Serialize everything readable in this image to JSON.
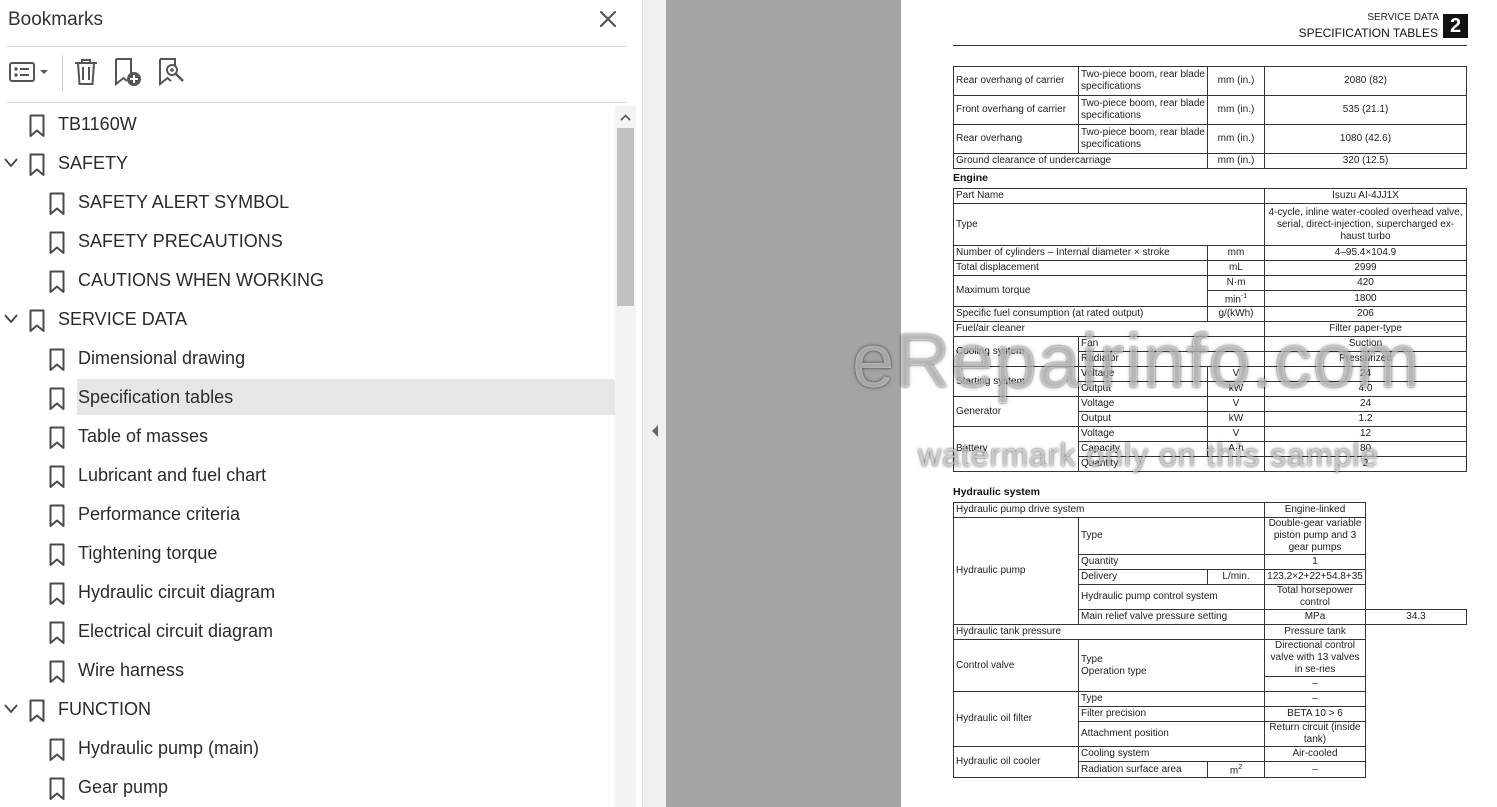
{
  "panel": {
    "title": "Bookmarks"
  },
  "bookmarks": [
    {
      "label": "TB1160W",
      "level": 0,
      "expandable": false
    },
    {
      "label": "SAFETY",
      "level": 0,
      "expandable": true
    },
    {
      "label": "SAFETY ALERT SYMBOL",
      "level": 1
    },
    {
      "label": "SAFETY PRECAUTIONS",
      "level": 1
    },
    {
      "label": "CAUTIONS WHEN WORKING",
      "level": 1
    },
    {
      "label": "SERVICE DATA",
      "level": 0,
      "expandable": true
    },
    {
      "label": "Dimensional drawing",
      "level": 1
    },
    {
      "label": "Specification tables",
      "level": 1,
      "selected": true
    },
    {
      "label": "Table of masses",
      "level": 1
    },
    {
      "label": "Lubricant and fuel chart",
      "level": 1
    },
    {
      "label": "Performance criteria",
      "level": 1
    },
    {
      "label": "Tightening torque",
      "level": 1
    },
    {
      "label": "Hydraulic circuit diagram",
      "level": 1
    },
    {
      "label": "Electrical circuit diagram",
      "level": 1
    },
    {
      "label": "Wire harness",
      "level": 1
    },
    {
      "label": "FUNCTION",
      "level": 0,
      "expandable": true
    },
    {
      "label": "Hydraulic pump (main)",
      "level": 1
    },
    {
      "label": "Gear pump",
      "level": 1
    }
  ],
  "document": {
    "header_section": "SERVICE DATA",
    "header_title": "SPECIFICATION TABLES",
    "chapter_number": "2",
    "engine_heading": "Engine",
    "hydraulic_heading": "Hydraulic system",
    "watermark_main": "eRepairinfo.com",
    "watermark_sub": "watermark only on this sample",
    "t1": [
      {
        "label": "Rear overhang of carrier",
        "sub": "Two-piece boom, rear blade specifications",
        "unit": "mm (in.)",
        "value": "2080 (82)"
      },
      {
        "label": "Front overhang of carrier",
        "sub": "Two-piece boom, rear blade specifications",
        "unit": "mm (in.)",
        "value": "535 (21.1)"
      },
      {
        "label": "Rear overhang",
        "sub": "Two-piece boom, rear blade specifications",
        "unit": "mm (in.)",
        "value": "1080 (42.6)"
      },
      {
        "label": "Ground clearance of undercarriage",
        "unit": "mm (in.)",
        "value": "320 (12.5)"
      }
    ],
    "eng": {
      "part_name": {
        "label": "Part Name",
        "value": "Isuzu AI-4JJ1X"
      },
      "type": {
        "label": "Type",
        "value": "4-cycle, inline water-cooled overhead valve, serial, direct-injection, supercharged ex-haust turbo"
      },
      "cyl": {
        "label": "Number of cylinders – Internal diameter × stroke",
        "unit": "mm",
        "value": "4–95.4×104.9"
      },
      "disp": {
        "label": "Total displacement",
        "unit": "mL",
        "value": "2999"
      },
      "torque": {
        "label": "Maximum torque",
        "unit1": "N·m",
        "value1": "420",
        "unit2": "min",
        "unit2_sup": "-1",
        "value2": "1800"
      },
      "sfc": {
        "label": "Specific fuel consumption (at rated output)",
        "unit": "g/(kWh)",
        "value": "206"
      },
      "filter": {
        "label": "Fuel/air cleaner",
        "value": "Filter paper-type"
      },
      "cooling": {
        "label": "Cooling system",
        "r1": "Fan",
        "v1": "Suction",
        "r2": "Radiator",
        "v2": "Pressurized"
      },
      "starting": {
        "label": "Starting system",
        "r1": "Voltage",
        "u1": "V",
        "v1": "24",
        "r2": "Output",
        "u2": "kW",
        "v2": "4.0"
      },
      "generator": {
        "label": "Generator",
        "r1": "Voltage",
        "u1": "V",
        "v1": "24",
        "r2": "Output",
        "u2": "kW",
        "v2": "1.2"
      },
      "battery": {
        "label": "Battery",
        "r1": "Voltage",
        "u1": "V",
        "v1": "12",
        "r2": "Capacity",
        "u2": "A·h",
        "v2": "80",
        "r3": "Quantity",
        "v3": "2"
      }
    },
    "hyd": {
      "drive": {
        "label": "Hydraulic pump drive system",
        "value": "Engine-linked"
      },
      "pump": {
        "label": "Hydraulic pump",
        "r1": "Type",
        "v1": "Double-gear variable piston pump and 3 gear pumps",
        "r2": "Quantity",
        "v2": "1",
        "r3": "Delivery",
        "u3": "L/min.",
        "v3": "123.2×2+22+54.8+35",
        "r4": "Hydraulic pump control system",
        "v4": "Total horsepower control"
      },
      "relief": {
        "label": "Main relief valve pressure setting",
        "unit": "MPa",
        "value": "34.3"
      },
      "tank": {
        "label": "Hydraulic tank pressure",
        "value": "Pressure tank"
      },
      "cv": {
        "label": "Control valve",
        "r1": "Type",
        "r2": "Operation type",
        "v1": "Directional control valve with 13 valves in se-ries",
        "v2": "–"
      },
      "oilfilter": {
        "label": "Hydraulic oil filter",
        "r1": "Type",
        "v1": "–",
        "r2": "Filter precision",
        "v2": "BETA 10 > 6",
        "r3": "Attachment position",
        "v3": "Return circuit (inside tank)"
      },
      "cooler": {
        "label": "Hydraulic oil cooler",
        "r1": "Cooling system",
        "v1": "Air-cooled",
        "r2": "Radiation surface area",
        "u2": "m",
        "u2_sup": "2",
        "v2": "–"
      }
    }
  }
}
